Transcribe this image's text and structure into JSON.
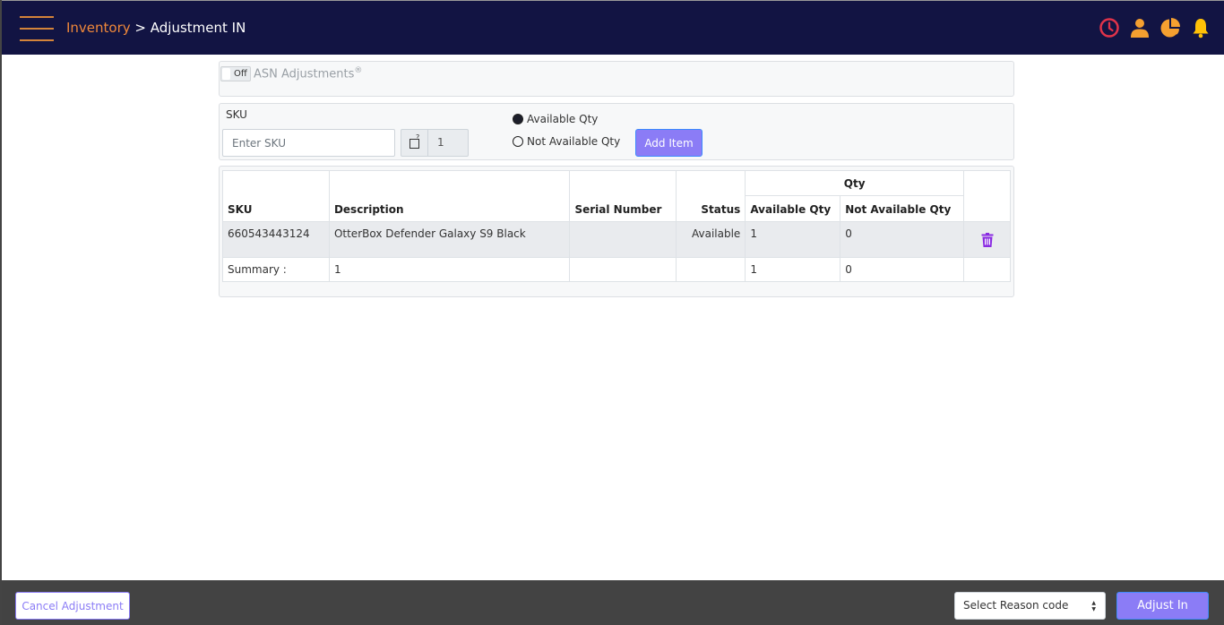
{
  "header": {
    "breadcrumb_link": "Inventory",
    "breadcrumb_sep": " > ",
    "breadcrumb_current": "Adjustment IN",
    "icons": [
      "clock-icon",
      "user-icon",
      "pie-chart-icon",
      "bell-icon"
    ],
    "colors": {
      "bar": "#121443",
      "accent": "#f0883a",
      "clock": "#e0334a",
      "bell": "#ffc107"
    }
  },
  "asn": {
    "toggle_label": "Off",
    "label": "ASN Adjustments",
    "help_mark": "®"
  },
  "sku_form": {
    "label": "SKU",
    "placeholder": "Enter SKU",
    "value": "",
    "qty_value": "1",
    "help_mark": "?",
    "radios": [
      {
        "label": "Available Qty",
        "selected": true
      },
      {
        "label": "Not Available Qty",
        "selected": false
      }
    ],
    "add_button": "Add Item"
  },
  "table": {
    "group_header": "Qty",
    "columns": [
      "SKU",
      "Description",
      "Serial Number",
      "Status",
      "Available Qty",
      "Not Available Qty"
    ],
    "rows": [
      {
        "sku": "660543443124",
        "description": "OtterBox Defender Galaxy S9 Black",
        "serial": "",
        "status": "Available",
        "available_qty": "1",
        "not_available_qty": "0"
      }
    ],
    "summary": {
      "label": "Summary :",
      "description": "1",
      "available_qty": "1",
      "not_available_qty": "0"
    }
  },
  "footer": {
    "cancel_button": "Cancel Adjustment",
    "reason_select": "Select Reason code",
    "adjust_button": "Adjust In",
    "accent": "#8b7cf6"
  }
}
